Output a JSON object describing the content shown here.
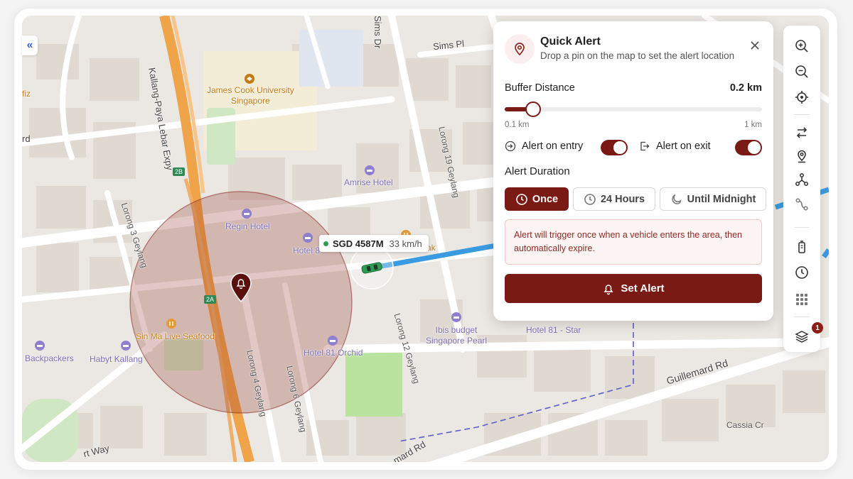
{
  "map": {
    "labels": {
      "kallang_paya_lebar": "Kallang-Paya Lebar Expy",
      "james_cook": "James Cook University\nSingapore",
      "sims_dr": "Sims Dr",
      "sims_pl": "Sims Pl",
      "lorong_19": "Lorong 19 Geylang",
      "amrise": "Amrise Hotel",
      "lorong_3": "Lorong 3 Geylang",
      "regin": "Regin Hotel",
      "hotel_81_partial": "Hotel 8",
      "wak_partial": "ak",
      "sin_ma": "Sin Ma Live Seafood",
      "backpackers": "Backpackers",
      "habyt": "Habyt Kallang",
      "hotel_81_orchid": "Hotel 81 Orchid",
      "lorong_4": "Lorong 4 Geylang",
      "lorong_6": "Lorong 6 Geylang",
      "lorong_12": "Lorong 12 Geylang",
      "ibis": "Ibis budget\nSingapore Pearl",
      "hotel_81_star": "Hotel 81 - Star",
      "guillemard": "Guillemard Rd",
      "cassia": "Cassia Cr",
      "mard_rd": "mard Rd",
      "rt_way": "rt Way",
      "fiz": "fiz",
      "rd_left": "rd",
      "badge_2b": "2B",
      "badge_2a": "2A"
    },
    "collapse_icon": "chevron-double-left-icon"
  },
  "vehicle": {
    "plate": "SGD 4587M",
    "speed": "33 km/h",
    "status_color": "#2e9c52"
  },
  "panel": {
    "title": "Quick Alert",
    "subtitle": "Drop a pin on the map to set the alert location",
    "buffer_label": "Buffer Distance",
    "buffer_value": "0.2 km",
    "slider_min": "0.1 km",
    "slider_max": "1 km",
    "slider_fraction": 0.11,
    "alert_on_entry": "Alert on entry",
    "alert_on_exit": "Alert on exit",
    "entry_enabled": true,
    "exit_enabled": true,
    "duration_title": "Alert Duration",
    "durations": [
      "Once",
      "24 Hours",
      "Until Midnight"
    ],
    "selected_duration": "Once",
    "info_text": "Alert will trigger once when a vehicle enters the area, then automatically expire.",
    "set_button": "Set Alert"
  },
  "toolbar": {
    "tools": [
      "zoom-in-icon",
      "zoom-out-icon",
      "locate-icon",
      "route-icon",
      "pin-icon",
      "network-icon",
      "path-icon",
      "battery-icon",
      "clock-icon",
      "grid-icon",
      "layers-icon"
    ],
    "layers_badge": "1"
  },
  "colors": {
    "accent": "#7a1a14",
    "route": "#3b9be0",
    "geofence": "#8b2a22"
  }
}
